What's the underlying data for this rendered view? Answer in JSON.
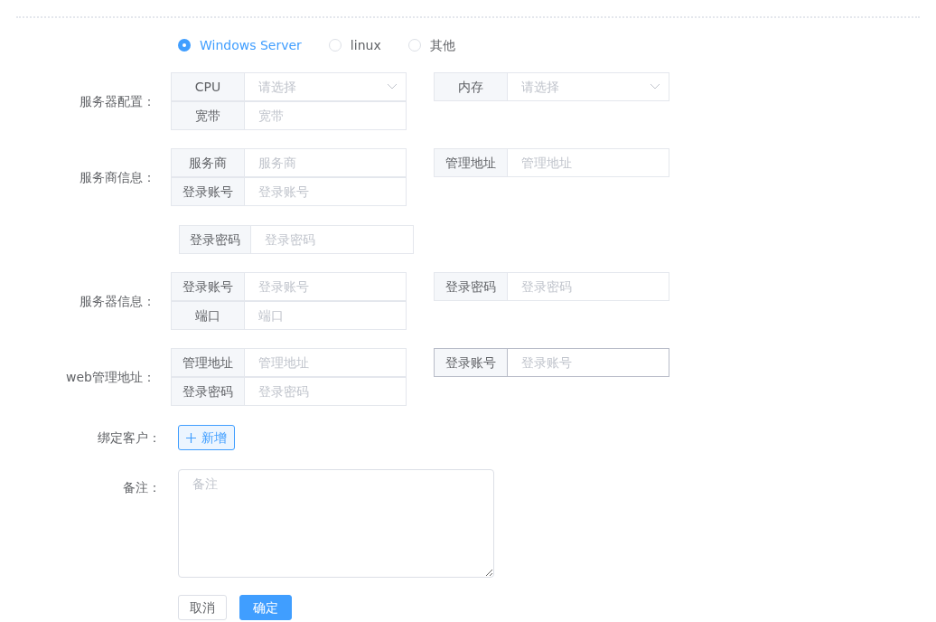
{
  "os_options": [
    {
      "label": "Windows Server",
      "selected": true
    },
    {
      "label": "linux",
      "selected": false
    },
    {
      "label": "其他",
      "selected": false
    }
  ],
  "sections": [
    {
      "kind": "grouped",
      "label": "服务器配置：",
      "left": [
        {
          "kind": "select",
          "addon": "CPU",
          "placeholder": "请选择",
          "focused": false
        },
        {
          "kind": "input",
          "addon": "宽带",
          "placeholder": "宽带",
          "focused": false
        }
      ],
      "right": [
        {
          "kind": "select",
          "addon": "内存",
          "placeholder": "请选择",
          "focused": false
        }
      ]
    },
    {
      "kind": "grouped",
      "label": "服务商信息：",
      "left": [
        {
          "kind": "input",
          "addon": "服务商",
          "placeholder": "服务商",
          "focused": false
        },
        {
          "kind": "input",
          "addon": "登录账号",
          "placeholder": "登录账号",
          "focused": false
        }
      ],
      "right": [
        {
          "kind": "input",
          "addon": "管理地址",
          "placeholder": "管理地址",
          "focused": false
        }
      ]
    },
    {
      "kind": "single",
      "left": [
        {
          "kind": "input",
          "addon": "登录密码",
          "placeholder": "登录密码",
          "focused": false
        }
      ]
    },
    {
      "kind": "grouped",
      "label": "服务器信息：",
      "left": [
        {
          "kind": "input",
          "addon": "登录账号",
          "placeholder": "登录账号",
          "focused": false
        },
        {
          "kind": "input",
          "addon": "端口",
          "placeholder": "端口",
          "focused": false
        }
      ],
      "right": [
        {
          "kind": "input",
          "addon": "登录密码",
          "placeholder": "登录密码",
          "focused": false
        }
      ]
    },
    {
      "kind": "grouped",
      "label": "web管理地址：",
      "left": [
        {
          "kind": "input",
          "addon": "管理地址",
          "placeholder": "管理地址",
          "focused": false
        },
        {
          "kind": "input",
          "addon": "登录密码",
          "placeholder": "登录密码",
          "focused": false
        }
      ],
      "right": [
        {
          "kind": "input",
          "addon": "登录账号",
          "placeholder": "登录账号",
          "focused": true
        }
      ]
    }
  ],
  "bind_customer": {
    "label": "绑定客户：",
    "button": "新增"
  },
  "remark": {
    "label": "备注：",
    "placeholder": "备注"
  },
  "buttons": [
    {
      "kind": "cancel",
      "label": "取消"
    },
    {
      "kind": "confirm",
      "label": "确定"
    }
  ]
}
